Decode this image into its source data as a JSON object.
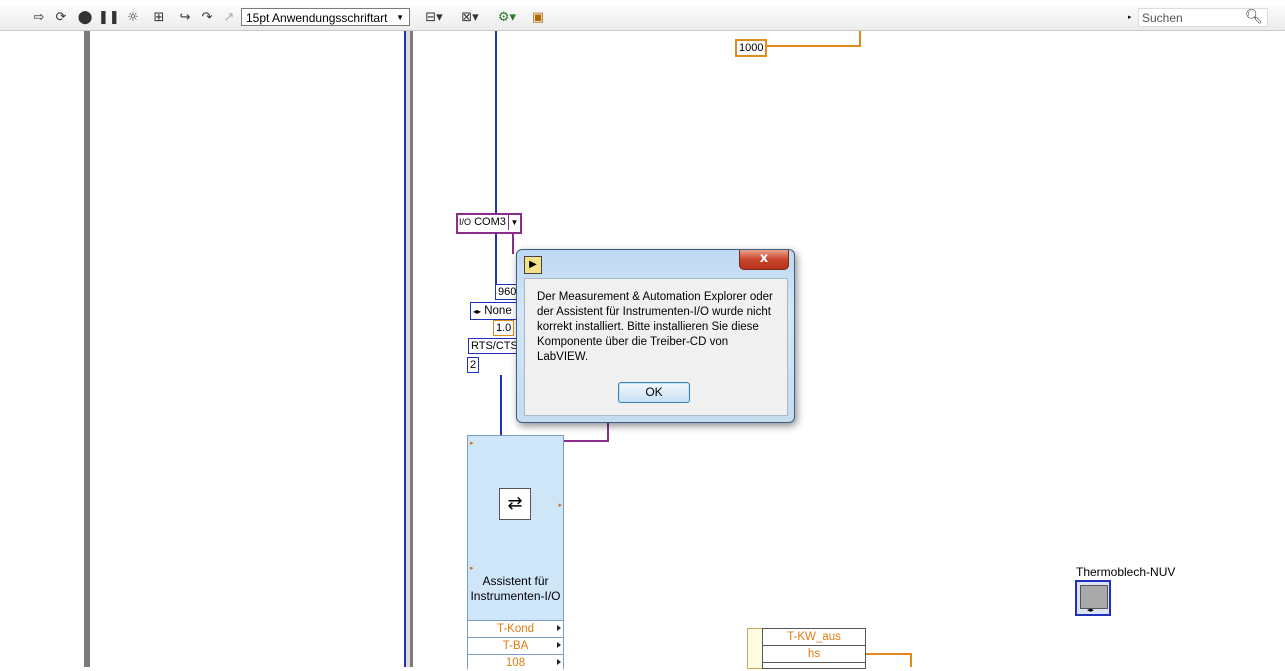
{
  "toolbar": {
    "font": "15pt Anwendungsschriftart",
    "search_placeholder": "Suchen"
  },
  "diagram": {
    "const_1000": "1000",
    "visa_resource": "COM3",
    "baud": "960",
    "parity": "None",
    "stopbits": "1.0",
    "flow": "RTS/CTS",
    "const_2": "2",
    "express_vi": {
      "label": "Assistent für Instrumenten-I/O",
      "outputs": [
        "T-Kond",
        "T-BA",
        "108"
      ]
    },
    "cluster": {
      "rows": [
        "T-KW_aus",
        "hs"
      ]
    },
    "indicator_label": "Thermoblech-NUV"
  },
  "dialog": {
    "message": "Der Measurement & Automation Explorer oder der Assistent für Instrumenten-I/O wurde nicht korrekt installiert. Bitte installieren Sie diese Komponente über die Treiber-CD von LabVIEW.",
    "ok_label": "OK",
    "close_label": "x"
  }
}
